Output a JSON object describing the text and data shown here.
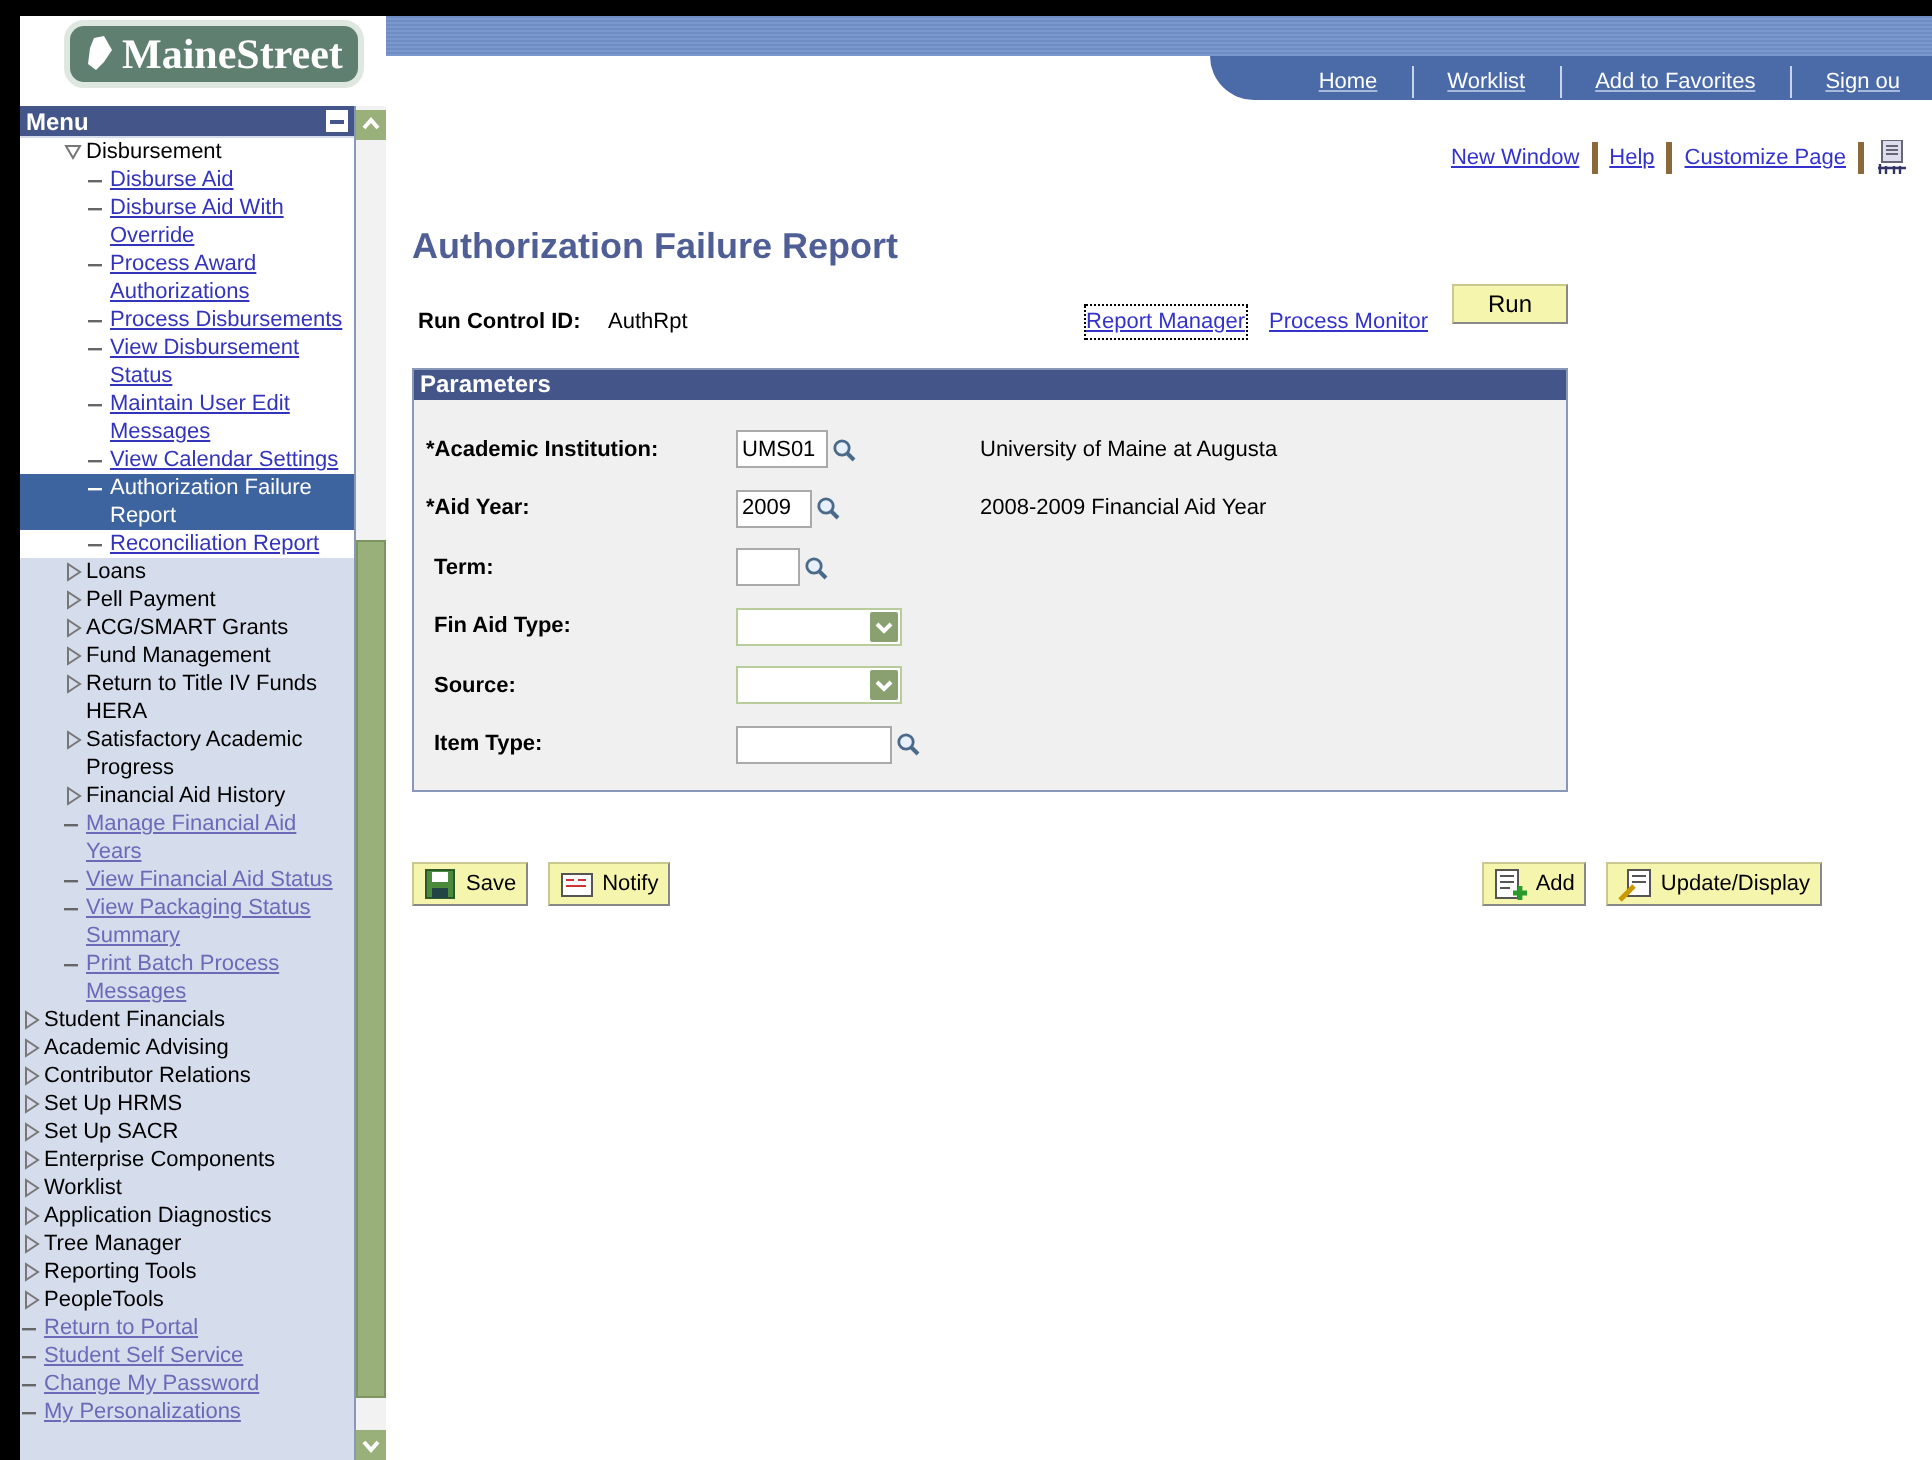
{
  "logo": {
    "text": "MaineStreet"
  },
  "header_nav": [
    "Home",
    "Worklist",
    "Add to Favorites",
    "Sign ou"
  ],
  "menu": {
    "title": "Menu",
    "nested_items": [
      {
        "label": "Disbursement",
        "kind": "folder",
        "expanded": true,
        "children": [
          {
            "label": "Disburse Aid",
            "kind": "link",
            "selected": false
          },
          {
            "label": "Disburse Aid With Override",
            "kind": "link",
            "selected": false
          },
          {
            "label": "Process Award Authorizations",
            "kind": "link",
            "selected": false
          },
          {
            "label": "Process Disbursements",
            "kind": "link",
            "selected": false
          },
          {
            "label": "View Disbursement Status",
            "kind": "link",
            "selected": false
          },
          {
            "label": "Maintain User Edit Messages",
            "kind": "link",
            "selected": false
          },
          {
            "label": "View Calendar Settings",
            "kind": "link",
            "selected": false
          },
          {
            "label": "Authorization Failure Report",
            "kind": "link",
            "selected": true
          },
          {
            "label": "Reconciliation Report",
            "kind": "link",
            "selected": false
          }
        ]
      },
      {
        "label": "Loans",
        "kind": "folder",
        "expanded": false
      },
      {
        "label": "Pell Payment",
        "kind": "folder",
        "expanded": false
      },
      {
        "label": "ACG/SMART Grants",
        "kind": "folder",
        "expanded": false
      },
      {
        "label": "Fund Management",
        "kind": "folder",
        "expanded": false
      },
      {
        "label": "Return to Title IV Funds HERA",
        "kind": "folder",
        "expanded": false
      },
      {
        "label": "Satisfactory Academic Progress",
        "kind": "folder",
        "expanded": false
      },
      {
        "label": "Financial Aid History",
        "kind": "folder",
        "expanded": false
      },
      {
        "label": "Manage Financial Aid Years",
        "kind": "link",
        "selected": false
      },
      {
        "label": "View Financial Aid Status",
        "kind": "link",
        "selected": false
      },
      {
        "label": "View Packaging Status Summary",
        "kind": "link",
        "selected": false
      },
      {
        "label": "Print Batch Process Messages",
        "kind": "link",
        "selected": false
      }
    ],
    "items": [
      {
        "label": "Student Financials",
        "kind": "folder",
        "expanded": false
      },
      {
        "label": "Academic Advising",
        "kind": "folder",
        "expanded": false
      },
      {
        "label": "Contributor Relations",
        "kind": "folder",
        "expanded": false
      },
      {
        "label": "Set Up HRMS",
        "kind": "folder",
        "expanded": false
      },
      {
        "label": "Set Up SACR",
        "kind": "folder",
        "expanded": false
      },
      {
        "label": "Enterprise Components",
        "kind": "folder",
        "expanded": false
      },
      {
        "label": "Worklist",
        "kind": "folder",
        "expanded": false
      },
      {
        "label": "Application Diagnostics",
        "kind": "folder",
        "expanded": false
      },
      {
        "label": "Tree Manager",
        "kind": "folder",
        "expanded": false
      },
      {
        "label": "Reporting Tools",
        "kind": "folder",
        "expanded": false
      },
      {
        "label": "PeopleTools",
        "kind": "folder",
        "expanded": false
      },
      {
        "label": "Return to Portal",
        "kind": "link",
        "selected": false
      },
      {
        "label": "Student Self Service",
        "kind": "link",
        "selected": false
      },
      {
        "label": "Change My Password",
        "kind": "link",
        "selected": false
      },
      {
        "label": "My Personalizations",
        "kind": "link",
        "selected": false
      }
    ]
  },
  "page_links": [
    "New Window",
    "Help",
    "Customize Page"
  ],
  "title": "Authorization Failure Report",
  "run_control": {
    "label": "Run Control ID:",
    "value": "AuthRpt"
  },
  "report_links": [
    "Report Manager",
    "Process Monitor"
  ],
  "run_button": "Run",
  "parameters": {
    "title": "Parameters",
    "fields": [
      {
        "kind": "lookup",
        "label": "*Academic Institution:",
        "value": "UMS01",
        "description": "University of Maine at Augusta"
      },
      {
        "kind": "lookup",
        "label": "*Aid Year:",
        "value": "2009",
        "description": "2008-2009 Financial Aid Year"
      },
      {
        "kind": "lookup",
        "label": "Term:"
      },
      {
        "kind": "dropdown",
        "label": "Fin Aid Type:"
      },
      {
        "kind": "dropdown",
        "label": "Source:"
      },
      {
        "kind": "lookup",
        "label": "Item Type:"
      }
    ]
  },
  "toolbar_left": [
    {
      "kind": "save",
      "label": "Save"
    },
    {
      "kind": "notify",
      "label": "Notify"
    }
  ],
  "toolbar_right": [
    {
      "kind": "add",
      "label": "Add"
    },
    {
      "kind": "update",
      "label": "Update/Display"
    }
  ]
}
